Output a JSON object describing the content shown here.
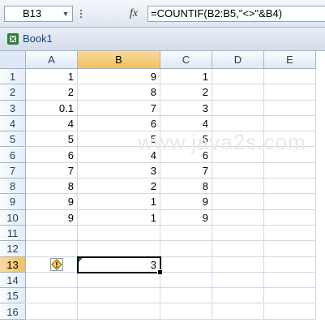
{
  "formula_bar": {
    "name_box": "B13",
    "fx_label": "fx",
    "formula": "=COUNTIF(B2:B5,\"<>\"&B4)"
  },
  "workbook": {
    "title": "Book1"
  },
  "columns": [
    "A",
    "B",
    "C",
    "D",
    "E"
  ],
  "rows": [
    {
      "num": "1",
      "A": "1",
      "B": "9",
      "C": "1"
    },
    {
      "num": "2",
      "A": "2",
      "B": "8",
      "C": "2"
    },
    {
      "num": "3",
      "A": "0.1",
      "B": "7",
      "C": "3"
    },
    {
      "num": "4",
      "A": "4",
      "B": "6",
      "C": "4"
    },
    {
      "num": "5",
      "A": "5",
      "B": "5",
      "C": "5"
    },
    {
      "num": "6",
      "A": "6",
      "B": "4",
      "C": "6"
    },
    {
      "num": "7",
      "A": "7",
      "B": "3",
      "C": "7"
    },
    {
      "num": "8",
      "A": "8",
      "B": "2",
      "C": "8"
    },
    {
      "num": "9",
      "A": "9",
      "B": "1",
      "C": "9"
    },
    {
      "num": "10",
      "A": "9",
      "B": "1",
      "C": "9"
    },
    {
      "num": "11",
      "A": "",
      "B": "",
      "C": ""
    },
    {
      "num": "12",
      "A": "",
      "B": "",
      "C": ""
    },
    {
      "num": "13",
      "A": "",
      "B": "3",
      "C": ""
    },
    {
      "num": "14",
      "A": "",
      "B": "",
      "C": ""
    },
    {
      "num": "15",
      "A": "",
      "B": "",
      "C": ""
    },
    {
      "num": "16",
      "A": "",
      "B": "",
      "C": ""
    }
  ],
  "selection": {
    "cell": "B13",
    "column": "B",
    "row": "13"
  },
  "watermark": "www.java2s.com",
  "icons": {
    "namebox_dropdown": "chevron-down-icon",
    "workbook": "excel-workbook-icon",
    "error_option": "warning-icon"
  }
}
